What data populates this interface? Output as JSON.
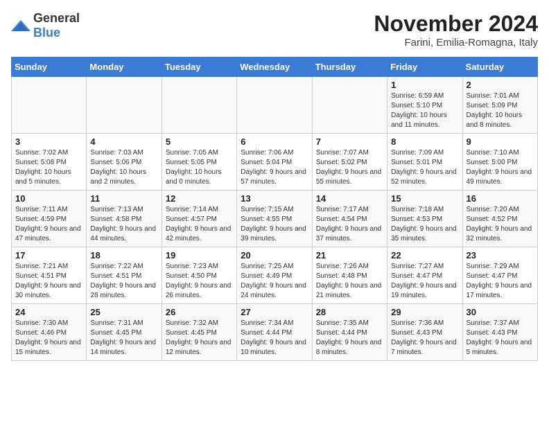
{
  "logo": {
    "general": "General",
    "blue": "Blue"
  },
  "header": {
    "month": "November 2024",
    "location": "Farini, Emilia-Romagna, Italy"
  },
  "weekdays": [
    "Sunday",
    "Monday",
    "Tuesday",
    "Wednesday",
    "Thursday",
    "Friday",
    "Saturday"
  ],
  "weeks": [
    [
      {
        "day": "",
        "info": ""
      },
      {
        "day": "",
        "info": ""
      },
      {
        "day": "",
        "info": ""
      },
      {
        "day": "",
        "info": ""
      },
      {
        "day": "",
        "info": ""
      },
      {
        "day": "1",
        "info": "Sunrise: 6:59 AM\nSunset: 5:10 PM\nDaylight: 10 hours and 11 minutes."
      },
      {
        "day": "2",
        "info": "Sunrise: 7:01 AM\nSunset: 5:09 PM\nDaylight: 10 hours and 8 minutes."
      }
    ],
    [
      {
        "day": "3",
        "info": "Sunrise: 7:02 AM\nSunset: 5:08 PM\nDaylight: 10 hours and 5 minutes."
      },
      {
        "day": "4",
        "info": "Sunrise: 7:03 AM\nSunset: 5:06 PM\nDaylight: 10 hours and 2 minutes."
      },
      {
        "day": "5",
        "info": "Sunrise: 7:05 AM\nSunset: 5:05 PM\nDaylight: 10 hours and 0 minutes."
      },
      {
        "day": "6",
        "info": "Sunrise: 7:06 AM\nSunset: 5:04 PM\nDaylight: 9 hours and 57 minutes."
      },
      {
        "day": "7",
        "info": "Sunrise: 7:07 AM\nSunset: 5:02 PM\nDaylight: 9 hours and 55 minutes."
      },
      {
        "day": "8",
        "info": "Sunrise: 7:09 AM\nSunset: 5:01 PM\nDaylight: 9 hours and 52 minutes."
      },
      {
        "day": "9",
        "info": "Sunrise: 7:10 AM\nSunset: 5:00 PM\nDaylight: 9 hours and 49 minutes."
      }
    ],
    [
      {
        "day": "10",
        "info": "Sunrise: 7:11 AM\nSunset: 4:59 PM\nDaylight: 9 hours and 47 minutes."
      },
      {
        "day": "11",
        "info": "Sunrise: 7:13 AM\nSunset: 4:58 PM\nDaylight: 9 hours and 44 minutes."
      },
      {
        "day": "12",
        "info": "Sunrise: 7:14 AM\nSunset: 4:57 PM\nDaylight: 9 hours and 42 minutes."
      },
      {
        "day": "13",
        "info": "Sunrise: 7:15 AM\nSunset: 4:55 PM\nDaylight: 9 hours and 39 minutes."
      },
      {
        "day": "14",
        "info": "Sunrise: 7:17 AM\nSunset: 4:54 PM\nDaylight: 9 hours and 37 minutes."
      },
      {
        "day": "15",
        "info": "Sunrise: 7:18 AM\nSunset: 4:53 PM\nDaylight: 9 hours and 35 minutes."
      },
      {
        "day": "16",
        "info": "Sunrise: 7:20 AM\nSunset: 4:52 PM\nDaylight: 9 hours and 32 minutes."
      }
    ],
    [
      {
        "day": "17",
        "info": "Sunrise: 7:21 AM\nSunset: 4:51 PM\nDaylight: 9 hours and 30 minutes."
      },
      {
        "day": "18",
        "info": "Sunrise: 7:22 AM\nSunset: 4:51 PM\nDaylight: 9 hours and 28 minutes."
      },
      {
        "day": "19",
        "info": "Sunrise: 7:23 AM\nSunset: 4:50 PM\nDaylight: 9 hours and 26 minutes."
      },
      {
        "day": "20",
        "info": "Sunrise: 7:25 AM\nSunset: 4:49 PM\nDaylight: 9 hours and 24 minutes."
      },
      {
        "day": "21",
        "info": "Sunrise: 7:26 AM\nSunset: 4:48 PM\nDaylight: 9 hours and 21 minutes."
      },
      {
        "day": "22",
        "info": "Sunrise: 7:27 AM\nSunset: 4:47 PM\nDaylight: 9 hours and 19 minutes."
      },
      {
        "day": "23",
        "info": "Sunrise: 7:29 AM\nSunset: 4:47 PM\nDaylight: 9 hours and 17 minutes."
      }
    ],
    [
      {
        "day": "24",
        "info": "Sunrise: 7:30 AM\nSunset: 4:46 PM\nDaylight: 9 hours and 15 minutes."
      },
      {
        "day": "25",
        "info": "Sunrise: 7:31 AM\nSunset: 4:45 PM\nDaylight: 9 hours and 14 minutes."
      },
      {
        "day": "26",
        "info": "Sunrise: 7:32 AM\nSunset: 4:45 PM\nDaylight: 9 hours and 12 minutes."
      },
      {
        "day": "27",
        "info": "Sunrise: 7:34 AM\nSunset: 4:44 PM\nDaylight: 9 hours and 10 minutes."
      },
      {
        "day": "28",
        "info": "Sunrise: 7:35 AM\nSunset: 4:44 PM\nDaylight: 9 hours and 8 minutes."
      },
      {
        "day": "29",
        "info": "Sunrise: 7:36 AM\nSunset: 4:43 PM\nDaylight: 9 hours and 7 minutes."
      },
      {
        "day": "30",
        "info": "Sunrise: 7:37 AM\nSunset: 4:43 PM\nDaylight: 9 hours and 5 minutes."
      }
    ]
  ]
}
